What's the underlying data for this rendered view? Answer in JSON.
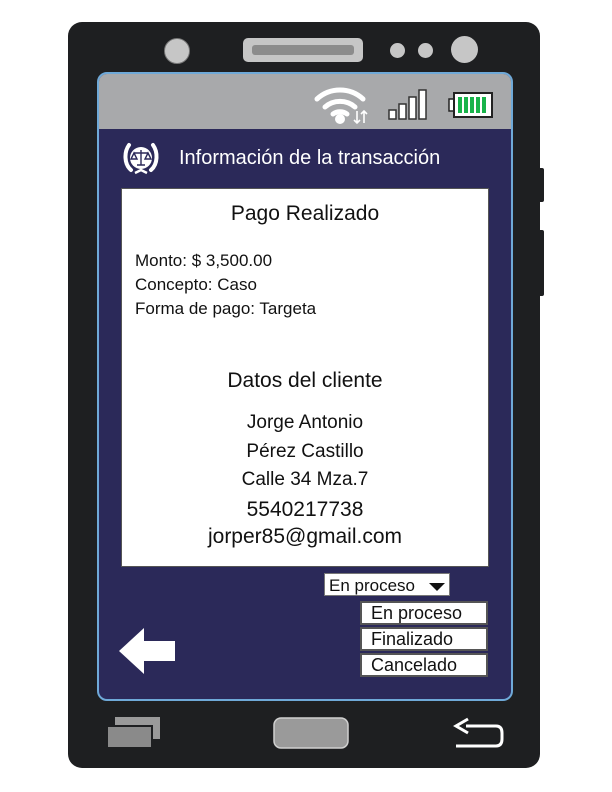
{
  "header": {
    "title": "Información de la transacción"
  },
  "payment": {
    "title": "Pago Realizado",
    "amount": "Monto: $ 3,500.00",
    "concept": "Concepto: Caso",
    "method": "Forma de pago: Targeta"
  },
  "client": {
    "title": "Datos del cliente",
    "first_name": "Jorge Antonio",
    "last_name": "Pérez Castillo",
    "address": "Calle 34 Mza.7",
    "phone": "5540217738",
    "email": "jorper85@gmail.com"
  },
  "status_dropdown": {
    "selected": "En proceso",
    "options": [
      "En proceso",
      "Finalizado",
      "Cancelado"
    ]
  },
  "icons": {
    "status_bar": [
      "wifi-icon",
      "signal-icon",
      "battery-icon"
    ],
    "header": "scales-of-justice-logo-icon",
    "bottom_nav": [
      "recent-apps-icon",
      "home-button",
      "back-icon"
    ],
    "screen": "back-arrow-icon"
  },
  "colors": {
    "screen_bg": "#2b2959",
    "status_bar": "#a8a9ab",
    "screen_border": "#6fa9d8",
    "battery": "#19b34a",
    "phone_body": "#1e1f21"
  }
}
